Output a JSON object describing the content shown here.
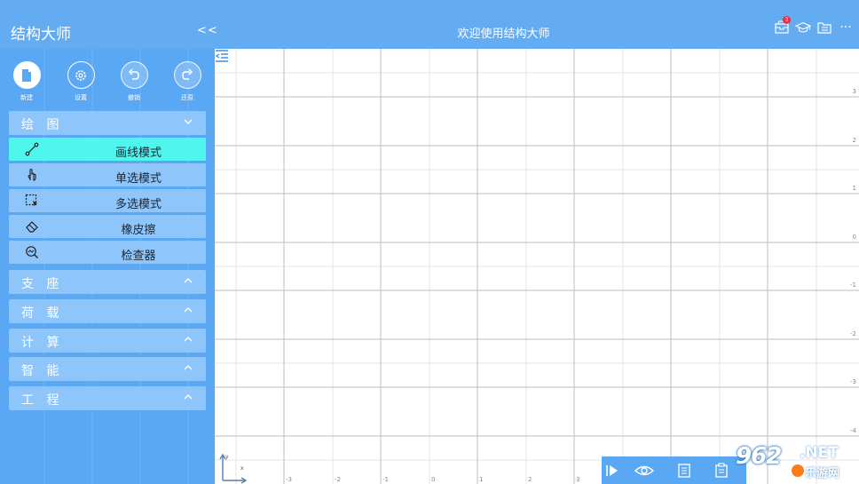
{
  "app": {
    "title": "结构大师",
    "collapse_label": "<<",
    "welcome": "欢迎使用结构大师",
    "notification_count": "3",
    "more_label": "···"
  },
  "toolbar": {
    "items": [
      {
        "label": "新建",
        "icon": "new-file-icon"
      },
      {
        "label": "设置",
        "icon": "settings-icon"
      },
      {
        "label": "撤销",
        "icon": "undo-icon"
      },
      {
        "label": "还原",
        "icon": "redo-icon"
      }
    ]
  },
  "sections": {
    "drawing": {
      "label": "绘 图",
      "expanded": true,
      "items": [
        {
          "label": "画线模式",
          "icon": "draw-line-icon",
          "active": true
        },
        {
          "label": "单选模式",
          "icon": "hand-pointer-icon",
          "active": false
        },
        {
          "label": "多选模式",
          "icon": "multi-select-icon",
          "active": false
        },
        {
          "label": "橡皮擦",
          "icon": "eraser-icon",
          "active": false
        },
        {
          "label": "检查器",
          "icon": "inspector-icon",
          "active": false
        }
      ]
    },
    "collapsed": [
      {
        "label": "支 座"
      },
      {
        "label": "荷 载"
      },
      {
        "label": "计 算"
      },
      {
        "label": "智 能"
      },
      {
        "label": "工 程"
      }
    ]
  },
  "canvas": {
    "y_ticks": [
      "3",
      "2",
      "1",
      "0",
      "-1",
      "-2",
      "-3",
      "-4"
    ],
    "x_ticks": [
      "-3",
      "-2",
      "-1",
      "0",
      "1",
      "2",
      "3"
    ],
    "axis_labels": {
      "x": "x",
      "y": "y"
    }
  },
  "bottom_toolbar": {
    "icons": [
      "play-step-icon",
      "eye-icon",
      "document-icon",
      "clipboard-icon"
    ]
  },
  "watermark": {
    "number": "962",
    "suffix": ".NET",
    "site": "乐游网"
  },
  "colors": {
    "topbar": "#64acf2",
    "sidebar": "#5aa8f4",
    "panel": "#8ec6fb",
    "active": "#4ff6ee",
    "grid": "#bbbbbb"
  }
}
